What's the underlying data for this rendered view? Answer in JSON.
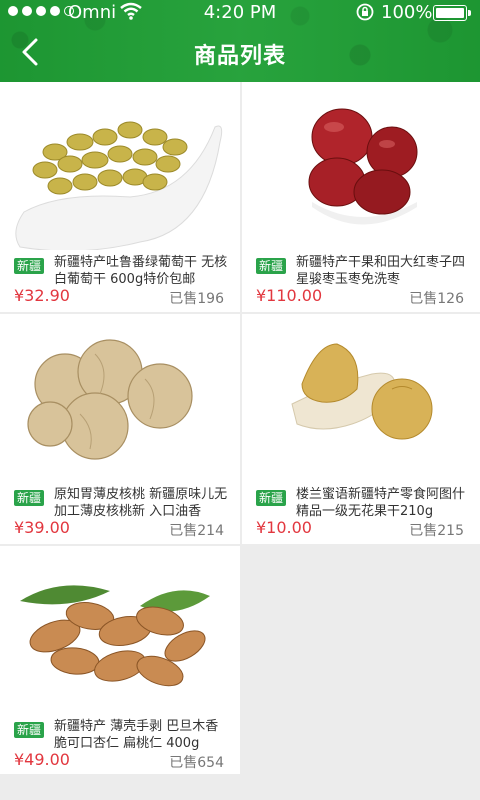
{
  "status_bar": {
    "carrier": "Omni",
    "time": "4:20 PM",
    "battery": "100%"
  },
  "header": {
    "title": "商品列表"
  },
  "colors": {
    "header_green": "#1f9f35",
    "tag_green": "#2aa34a",
    "price_red": "#e2373f"
  },
  "products": [
    {
      "tag": "新疆",
      "name": "新疆特产吐鲁番绿葡萄干 无核白葡萄干 600g特价包邮",
      "price": "¥32.90",
      "sold": "已售196",
      "image": "green-raisins-in-spoon"
    },
    {
      "tag": "新疆",
      "name": "新疆特产干果和田大红枣子四星骏枣玉枣免洗枣",
      "price": "¥110.00",
      "sold": "已售126",
      "image": "red-dates-in-bowl"
    },
    {
      "tag": "新疆",
      "name": "原知胃薄皮核桃 新疆原味儿无加工薄皮核桃新 入口油香",
      "price": "¥39.00",
      "sold": "已售214",
      "image": "walnuts"
    },
    {
      "tag": "新疆",
      "name": "楼兰蜜语新疆特产零食阿图什精品一级无花果干210g",
      "price": "¥10.00",
      "sold": "已售215",
      "image": "dried-figs"
    },
    {
      "tag": "新疆",
      "name": "新疆特产 薄壳手剥 巴旦木香脆可口杏仁 扁桃仁 400g",
      "price": "¥49.00",
      "sold": "已售654",
      "image": "almonds-with-leaves"
    }
  ]
}
